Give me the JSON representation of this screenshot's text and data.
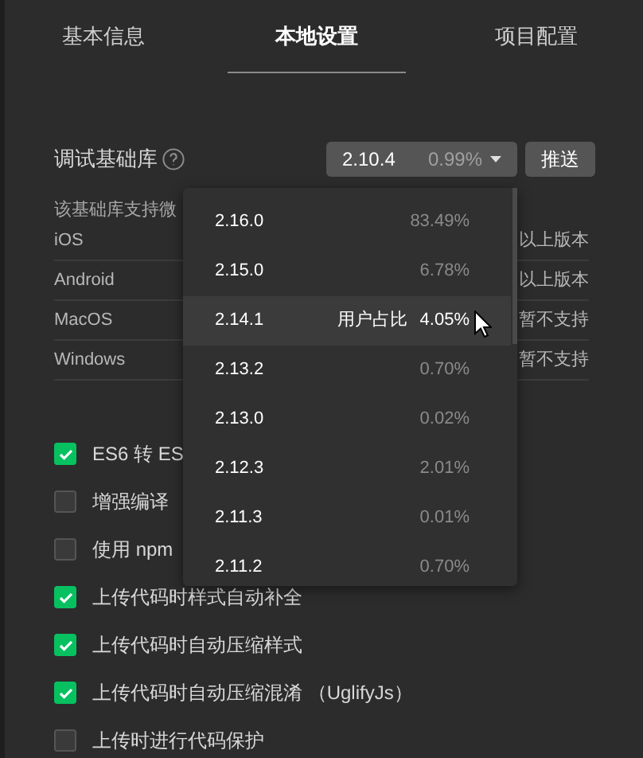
{
  "tabs": [
    {
      "label": "基本信息",
      "selected": false
    },
    {
      "label": "本地设置",
      "selected": true
    },
    {
      "label": "项目配置",
      "selected": false
    }
  ],
  "debug_lib": {
    "label": "调试基础库",
    "version": "2.10.4",
    "share": "0.99%",
    "push_button": "推送"
  },
  "support_note": "该基础库支持微",
  "platforms": [
    {
      "name": "iOS",
      "value": "以上版本"
    },
    {
      "name": "Android",
      "value": "以上版本"
    },
    {
      "name": "MacOS",
      "value": "暂不支持"
    },
    {
      "name": "Windows",
      "value": "暂不支持"
    }
  ],
  "options": [
    {
      "label": "ES6 转 ES",
      "checked": true
    },
    {
      "label": "增强编译",
      "checked": false
    },
    {
      "label": "使用 npm",
      "checked": false
    },
    {
      "label": "上传代码时样式自动补全",
      "checked": true
    },
    {
      "label": "上传代码时自动压缩样式",
      "checked": true
    },
    {
      "label": "上传代码时自动压缩混淆 （UglifyJs）",
      "checked": true
    },
    {
      "label": "上传时进行代码保护",
      "checked": false
    }
  ],
  "dropdown": {
    "items": [
      {
        "version": "2.16.0",
        "share": "83.49%",
        "selected": false
      },
      {
        "version": "2.15.0",
        "share": "6.78%",
        "selected": false
      },
      {
        "version": "2.14.1",
        "share": "4.05%",
        "hint": "用户占比",
        "selected": true
      },
      {
        "version": "2.13.2",
        "share": "0.70%",
        "selected": false
      },
      {
        "version": "2.13.0",
        "share": "0.02%",
        "selected": false
      },
      {
        "version": "2.12.3",
        "share": "2.01%",
        "selected": false
      },
      {
        "version": "2.11.3",
        "share": "0.01%",
        "selected": false
      },
      {
        "version": "2.11.2",
        "share": "0.70%",
        "selected": false
      }
    ]
  }
}
